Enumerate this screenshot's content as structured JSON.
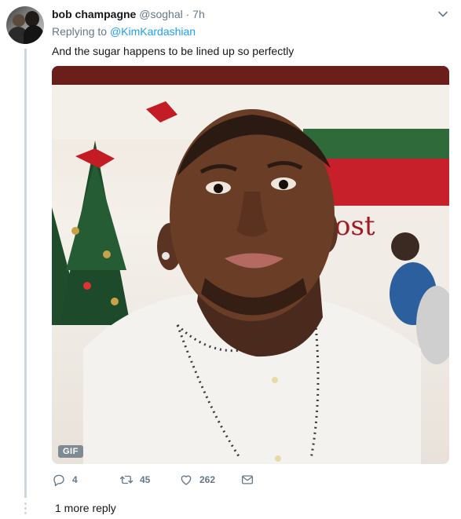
{
  "tweet": {
    "author_name": "bob champagne",
    "author_handle": "@soghal",
    "separator": "·",
    "time": "7h",
    "replying_prefix": "Replying to",
    "replying_to": "@KimKardashian",
    "text": "And the sugar happens to be lined up so perfectly",
    "media": {
      "badge": "GIF"
    },
    "actions": {
      "reply_count": "4",
      "retweet_count": "45",
      "like_count": "262"
    }
  },
  "thread": {
    "more_reply_label": "1 more reply"
  },
  "icons": {
    "reply": "reply-icon",
    "retweet": "retweet-icon",
    "like": "heart-icon",
    "dm": "envelope-icon",
    "menu": "chevron-down-icon"
  },
  "colors": {
    "accent": "#1da1f2",
    "muted": "#657786",
    "text": "#14171a",
    "thread_line": "#ccd6dd"
  }
}
